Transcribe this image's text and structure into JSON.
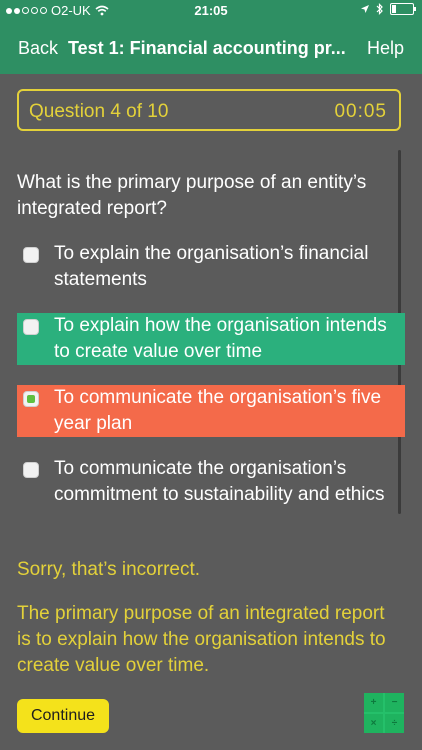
{
  "status_bar": {
    "carrier": "O2-UK",
    "time": "21:05"
  },
  "nav": {
    "back_label": "Back",
    "title": "Test 1: Financial accounting pr...",
    "help_label": "Help"
  },
  "question_header": {
    "number": "Question 4 of 10",
    "timer": "00:05"
  },
  "question": {
    "text": "What is the primary purpose of an entity’s integrated report?",
    "options": [
      {
        "text": "To explain the organisation’s financial statements",
        "checked": false,
        "state": "none"
      },
      {
        "text": "To explain how the organisation intends to create value over time",
        "checked": false,
        "state": "correct"
      },
      {
        "text": "To communicate the organisation’s five year plan",
        "checked": true,
        "state": "incorrect"
      },
      {
        "text": "To communicate the organisation’s commitment to sustainability and ethics",
        "checked": false,
        "state": "none"
      }
    ]
  },
  "feedback": {
    "result": "Sorry, that’s incorrect.",
    "explanation": "The primary purpose of an integrated report is to explain how the organisation intends to create value over time."
  },
  "actions": {
    "continue_label": "Continue",
    "calculator_symbols": [
      "+",
      "−",
      "×",
      "÷"
    ]
  },
  "colors": {
    "nav_green": "#2e8f63",
    "correct_green": "#2bb07d",
    "incorrect_orange": "#f46a4a",
    "accent_yellow": "#e3d13a",
    "button_yellow": "#f4e21b",
    "background": "#5b5b5b"
  },
  "icons": {
    "wifi": "wifi-icon",
    "location": "location-arrow-icon",
    "bluetooth": "bluetooth-icon",
    "battery": "battery-icon",
    "calculator": "calculator-icon"
  }
}
